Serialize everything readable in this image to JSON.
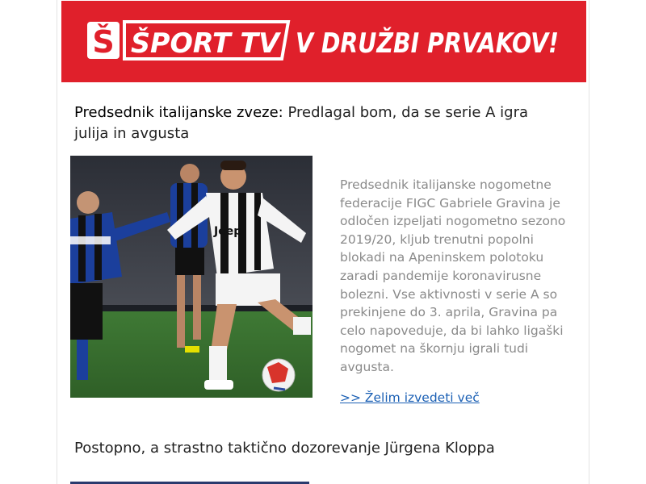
{
  "banner": {
    "logo_letter": "Š",
    "brand": "ŠPORT TV",
    "slogan": "V DRUŽBI PRVAKOV!",
    "colors": {
      "background": "#e0202b",
      "text": "#ffffff"
    }
  },
  "article": {
    "title_lead": "Predsednik italijanske zveze:",
    "title_rest": " Predlagal bom, da se serie A igra julija in avgusta",
    "image_icon": "football-match-photo",
    "jersey_text": "Jeep",
    "summary": "Predsednik italijanske nogometne federacije FIGC Gabriele Gravina je odločen izpeljati nogometno sezono 2019/20, kljub trenutni popolni blokadi na Apeninskem polotoku zaradi pandemije koronavirusne bolezni. Vse aktivnosti v serie A so prekinjene do 3. aprila, Gravina pa celo napoveduje, da bi lahko ligaški nogomet na škornju igrali tudi avgusta.",
    "read_more": ">> Želim izvedeti več",
    "link_color": "#1a5fb4"
  },
  "next_article": {
    "title": "Postopno, a strastno taktično dozorevanje Jürgena Kloppa"
  }
}
